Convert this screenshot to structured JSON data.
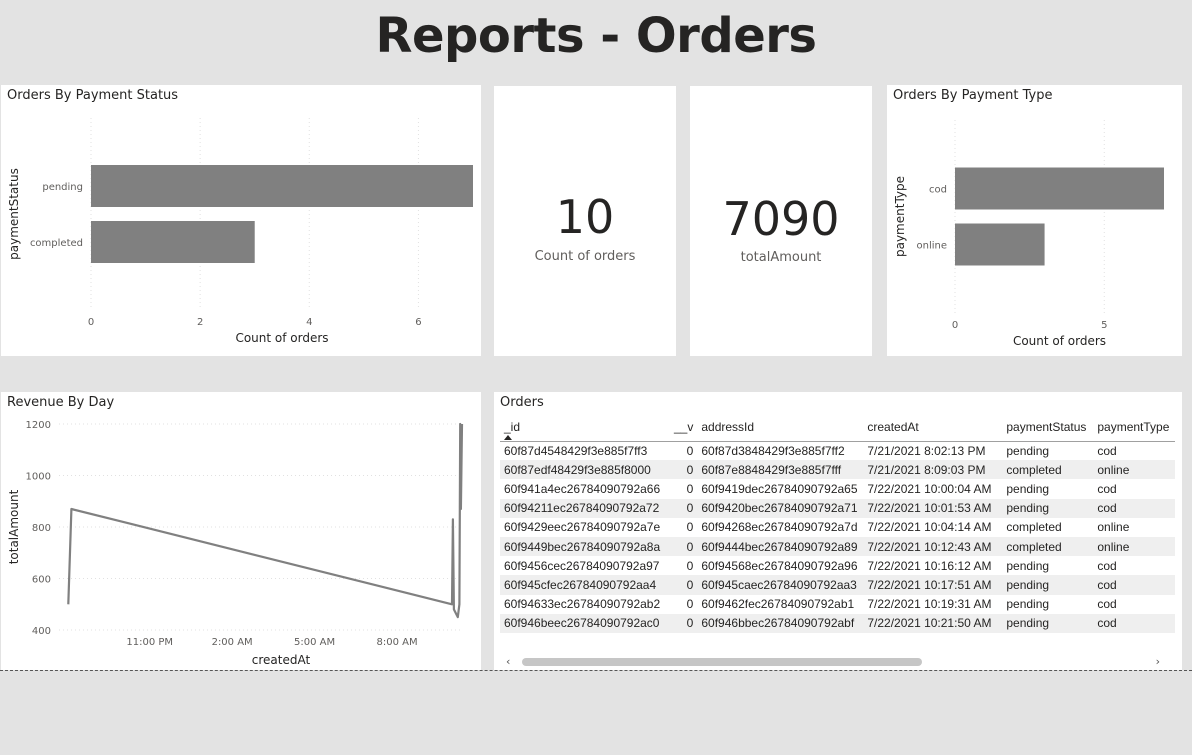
{
  "page": {
    "title": "Reports - Orders"
  },
  "payment_status_chart": {
    "title": "Orders By Payment Status",
    "chart_data": {
      "type": "bar",
      "orientation": "horizontal",
      "categories": [
        "pending",
        "completed"
      ],
      "values": [
        7,
        3
      ],
      "xlabel": "Count of orders",
      "ylabel": "paymentStatus",
      "xlim": [
        0,
        7
      ],
      "xticks": [
        "0",
        "2",
        "4",
        "6"
      ],
      "xtick_values": [
        0,
        2,
        4,
        6
      ],
      "grid": true,
      "color": "#808080"
    }
  },
  "count_card": {
    "value": "10",
    "label": "Count of orders"
  },
  "total_card": {
    "value": "7090",
    "label": "totalAmount"
  },
  "payment_type_chart": {
    "title": "Orders By Payment Type",
    "chart_data": {
      "type": "bar",
      "orientation": "horizontal",
      "categories": [
        "cod",
        "online"
      ],
      "values": [
        7,
        3
      ],
      "xlabel": "Count of orders",
      "ylabel": "paymentType",
      "xlim": [
        0,
        7
      ],
      "xticks": [
        "0",
        "5"
      ],
      "xtick_values": [
        0,
        5
      ],
      "grid": true,
      "color": "#808080"
    }
  },
  "revenue_chart": {
    "title": "Revenue By Day",
    "chart_data": {
      "type": "line",
      "x": [
        "7/21/2021 8:02:13 PM",
        "7/21/2021 8:09:03 PM",
        "7/22/2021 10:00:04 AM",
        "7/22/2021 10:01:53 AM",
        "7/22/2021 10:04:14 AM",
        "7/22/2021 10:12:43 AM",
        "7/22/2021 10:16:12 AM",
        "7/22/2021 10:17:51 AM",
        "7/22/2021 10:19:31 AM",
        "7/22/2021 10:21:50 AM"
      ],
      "y": [
        500,
        870,
        500,
        830,
        480,
        450,
        500,
        1200,
        870,
        1200
      ],
      "xlabel": "createdAt",
      "ylabel": "totalAmount",
      "ylim": [
        400,
        1200
      ],
      "yticks": [
        "400",
        "600",
        "800",
        "1000",
        "1200"
      ],
      "ytick_values": [
        400,
        600,
        800,
        1000,
        1200
      ],
      "xticks": [
        "11:00 PM",
        "2:00 AM",
        "5:00 AM",
        "8:00 AM"
      ],
      "xtick_values": [
        "7/21/2021 11:00 PM",
        "7/22/2021 2:00 AM",
        "7/22/2021 5:00 AM",
        "7/22/2021 8:00 AM"
      ],
      "xlim": [
        "7/21/2021 7:42 PM",
        "7/22/2021 10:24 AM"
      ],
      "grid": true,
      "color": "#808080"
    }
  },
  "orders_table": {
    "title": "Orders",
    "columns": [
      "_id",
      "__v",
      "addressId",
      "createdAt",
      "paymentStatus",
      "paymentType"
    ],
    "rows": [
      [
        "60f87d4548429f3e885f7ff3",
        "0",
        "60f87d3848429f3e885f7ff2",
        "7/21/2021 8:02:13 PM",
        "pending",
        "cod"
      ],
      [
        "60f87edf48429f3e885f8000",
        "0",
        "60f87e8848429f3e885f7fff",
        "7/21/2021 8:09:03 PM",
        "completed",
        "online"
      ],
      [
        "60f941a4ec26784090792a66",
        "0",
        "60f9419dec26784090792a65",
        "7/22/2021 10:00:04 AM",
        "pending",
        "cod"
      ],
      [
        "60f94211ec26784090792a72",
        "0",
        "60f9420bec26784090792a71",
        "7/22/2021 10:01:53 AM",
        "pending",
        "cod"
      ],
      [
        "60f9429eec26784090792a7e",
        "0",
        "60f94268ec26784090792a7d",
        "7/22/2021 10:04:14 AM",
        "completed",
        "online"
      ],
      [
        "60f9449bec26784090792a8a",
        "0",
        "60f9444bec26784090792a89",
        "7/22/2021 10:12:43 AM",
        "completed",
        "online"
      ],
      [
        "60f9456cec26784090792a97",
        "0",
        "60f94568ec26784090792a96",
        "7/22/2021 10:16:12 AM",
        "pending",
        "cod"
      ],
      [
        "60f945cfec26784090792aa4",
        "0",
        "60f945caec26784090792aa3",
        "7/22/2021 10:17:51 AM",
        "pending",
        "cod"
      ],
      [
        "60f94633ec26784090792ab2",
        "0",
        "60f9462fec26784090792ab1",
        "7/22/2021 10:19:31 AM",
        "pending",
        "cod"
      ],
      [
        "60f946beec26784090792ac0",
        "0",
        "60f946bbec26784090792abf",
        "7/22/2021 10:21:50 AM",
        "pending",
        "cod"
      ]
    ],
    "scroll_left": "‹",
    "scroll_right": "›"
  }
}
